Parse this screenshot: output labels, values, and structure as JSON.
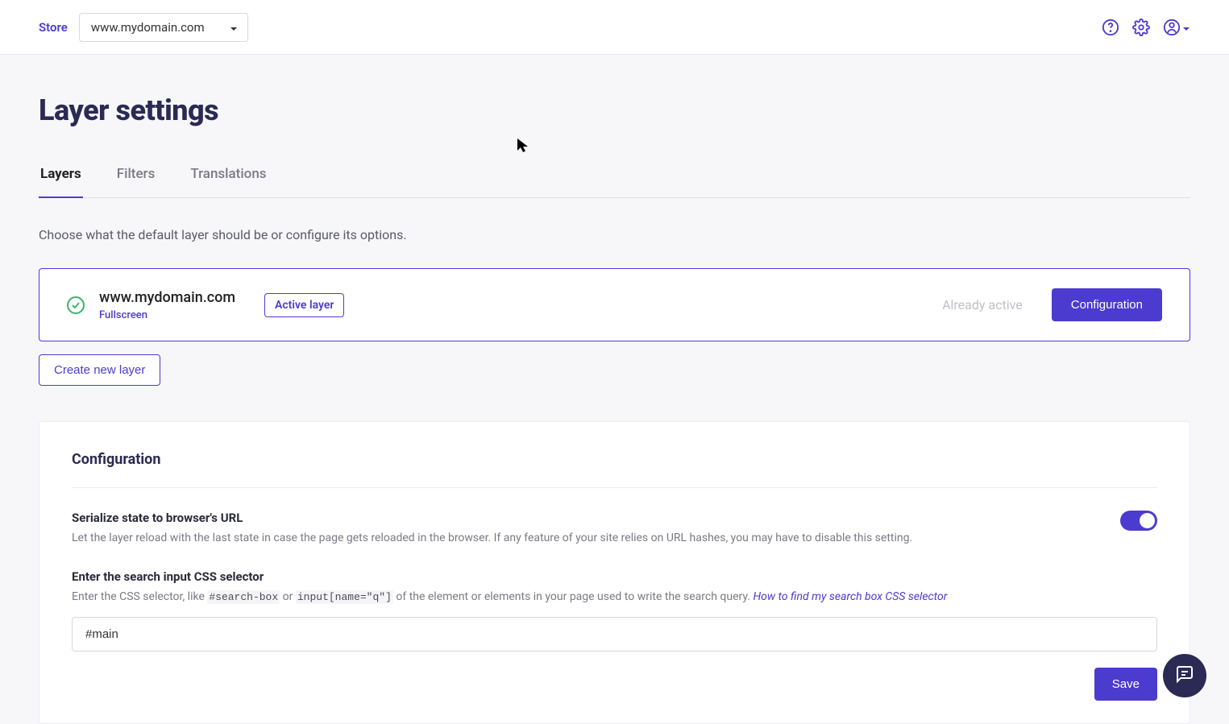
{
  "header": {
    "store_label": "Store",
    "store_value": "www.mydomain.com"
  },
  "page": {
    "title": "Layer settings",
    "helper_text": "Choose what the default layer should be or configure its options."
  },
  "tabs": {
    "layers": "Layers",
    "filters": "Filters",
    "translations": "Translations"
  },
  "layer": {
    "name": "www.mydomain.com",
    "subtype": "Fullscreen",
    "badge": "Active layer",
    "already": "Already active",
    "config_button": "Configuration"
  },
  "buttons": {
    "create_layer": "Create new layer",
    "save": "Save"
  },
  "config": {
    "panel_title": "Configuration",
    "serialize_title": "Serialize state to browser's URL",
    "serialize_desc": "Let the layer reload with the last state in case the page gets reloaded in the browser. If any feature of your site relies on URL hashes, you may have to disable this setting.",
    "selector_title": "Enter the search input CSS selector",
    "selector_desc_prefix": "Enter the CSS selector, like ",
    "selector_code1": "#search-box",
    "selector_desc_mid": " or ",
    "selector_code2": "input[name=\"q\"]",
    "selector_desc_suffix": " of the element or elements in your page used to write the search query. ",
    "selector_link": "How to find my search box CSS selector",
    "selector_value": "#main"
  }
}
